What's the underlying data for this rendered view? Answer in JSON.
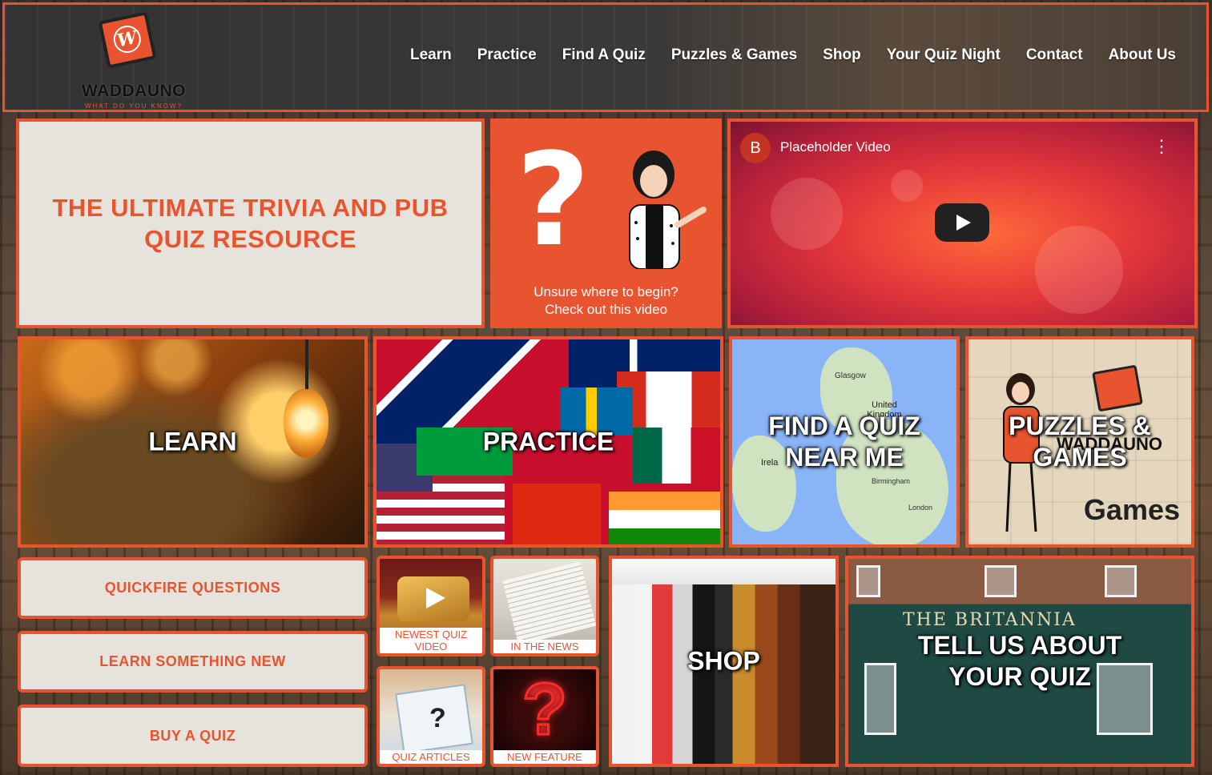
{
  "brand": {
    "name": "WADDAUNO",
    "tagline": "WHAT DO YOU KNOW?",
    "logo_letter": "W",
    "accent": "#e8542f"
  },
  "nav": {
    "items": [
      "Learn",
      "Practice",
      "Find A Quiz",
      "Puzzles & Games",
      "Shop",
      "Your Quiz Night",
      "Contact",
      "About Us"
    ]
  },
  "hero": {
    "title_line1": "THE ULTIMATE TRIVIA AND PUB",
    "title_line2": "QUIZ RESOURCE"
  },
  "unsure": {
    "mark": "?",
    "line1": "Unsure where to begin?",
    "line2": "Check out this video"
  },
  "video": {
    "avatar_letter": "B",
    "title": "Placeholder Video",
    "menu_icon": "more-vertical-icon"
  },
  "tiles": {
    "learn": "LEARN",
    "practice": "PRACTICE",
    "find_line1": "FIND A QUIZ",
    "find_line2": "NEAR ME",
    "puzzles_line1": "PUZZLES &",
    "puzzles_line2": "GAMES",
    "puzzles_games_word": "Games",
    "shop": "SHOP",
    "tell_line1": "TELL US ABOUT",
    "tell_line2": "YOUR QUIZ"
  },
  "buttons": {
    "quickfire": "QUICKFIRE QUESTIONS",
    "learn_new": "LEARN SOMETHING NEW",
    "buy": "BUY A QUIZ"
  },
  "small_tiles": {
    "newest": "NEWEST QUIZ VIDEO",
    "news": "IN THE NEWS",
    "articles": "QUIZ ARTICLES",
    "feature": "NEW FEATURE"
  },
  "map_labels": {
    "uk": "United Kingdom",
    "glasgow": "Glasgow",
    "ireland": "Irela",
    "birmingham": "Birmingham",
    "london": "London"
  },
  "pub_sign": "THE BRITANNIA"
}
